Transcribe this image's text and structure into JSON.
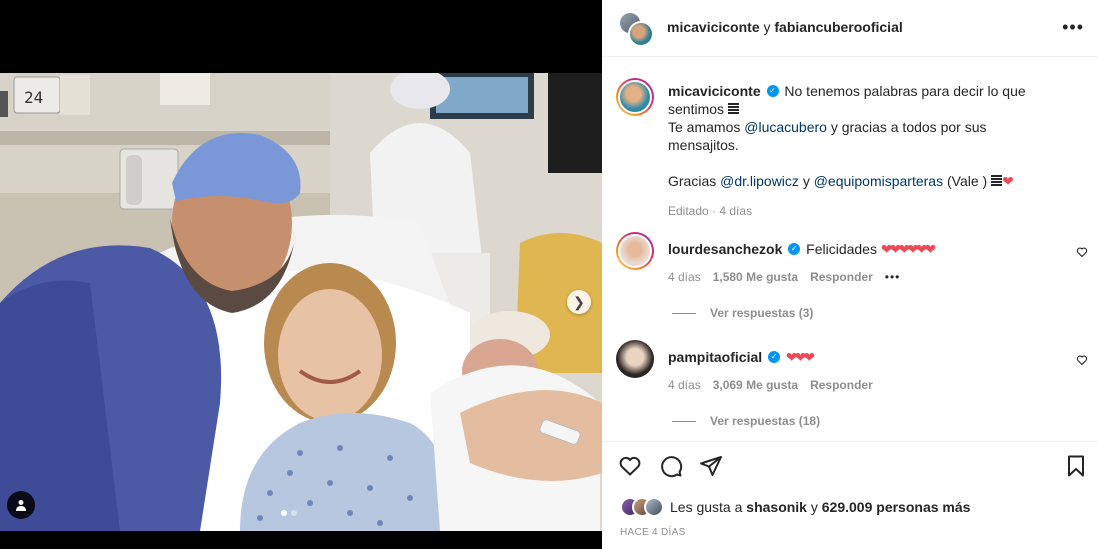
{
  "header": {
    "user1": "micaviciconte",
    "conjunction": "y",
    "user2": "fabiancuberooficial"
  },
  "caption": {
    "username": "micaviciconte",
    "line1": "No tenemos palabras para decir lo que sentimos",
    "line2_prefix": "Te amamos",
    "mention1": "@lucacubero",
    "line2_suffix": "y gracias a todos por sus mensajitos.",
    "line3_prefix": "Gracias",
    "mention2": "@dr.lipowicz",
    "line3_mid": "y",
    "mention3": "@equipomisparteras",
    "line3_suffix": "(Vale )",
    "edited": "Editado",
    "time": "4 días"
  },
  "comments": [
    {
      "username": "lourdesanchezok",
      "text": "Felicidades",
      "hearts": "❤❤❤❤❤❤",
      "time": "4 días",
      "likes": "1,580 Me gusta",
      "reply": "Responder",
      "more": "•••",
      "view_replies": "Ver respuestas (3)"
    },
    {
      "username": "pampitaoficial",
      "text": "",
      "hearts": "❤❤❤",
      "time": "4 días",
      "likes": "3,069 Me gusta",
      "reply": "Responder",
      "view_replies": "Ver respuestas (18)"
    }
  ],
  "likes": {
    "prefix": "Les gusta a",
    "user": "shasonik",
    "conj": "y",
    "count": "629.009 personas más"
  },
  "post_date": "HACE 4 DÍAS",
  "photo": {
    "monitor_reading": "24"
  },
  "icons": {
    "more": "more-options-icon",
    "like": "heart-icon",
    "comment": "comment-icon",
    "share": "send-icon",
    "save": "bookmark-icon",
    "next": "chevron-right-icon",
    "tag": "user-tag-icon"
  },
  "colors": {
    "accent": "#0095f6",
    "heart": "#ed4956",
    "link": "#00376b",
    "muted": "#8e8e8e"
  }
}
